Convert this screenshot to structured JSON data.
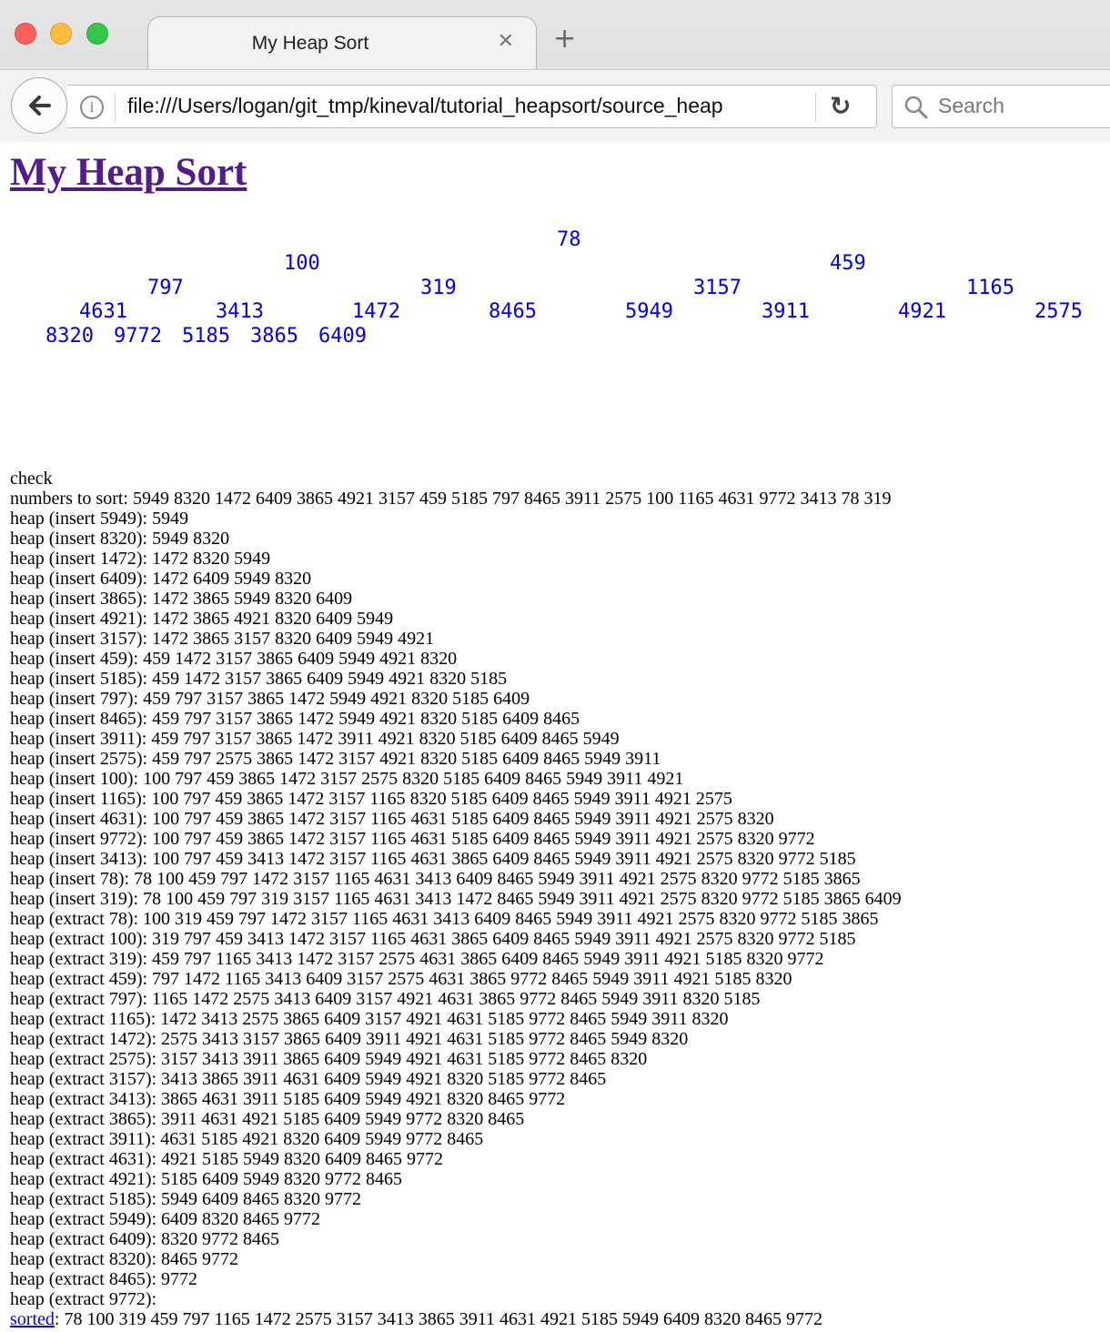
{
  "browser": {
    "tab_title": "My Heap Sort",
    "tab_close": "✕",
    "new_tab": "+",
    "url": "file:///Users/logan/git_tmp/kineval/tutorial_heapsort/source_heap",
    "search_placeholder": "Search"
  },
  "page": {
    "title": "My Heap Sort",
    "heap_rows": [
      [
        "78"
      ],
      [
        "100",
        "459"
      ],
      [
        "797",
        "319",
        "3157",
        "1165"
      ],
      [
        "4631",
        "3413",
        "1472",
        "8465",
        "5949",
        "3911",
        "4921",
        "2575"
      ],
      [
        "8320",
        "9772",
        "5185",
        "3865",
        "6409"
      ]
    ],
    "log_lines": [
      "check",
      "numbers to sort: 5949 8320 1472 6409 3865 4921 3157 459 5185 797 8465 3911 2575 100 1165 4631 9772 3413 78 319",
      "heap (insert 5949): 5949",
      "heap (insert 8320): 5949 8320",
      "heap (insert 1472): 1472 8320 5949",
      "heap (insert 6409): 1472 6409 5949 8320",
      "heap (insert 3865): 1472 3865 5949 8320 6409",
      "heap (insert 4921): 1472 3865 4921 8320 6409 5949",
      "heap (insert 3157): 1472 3865 3157 8320 6409 5949 4921",
      "heap (insert 459): 459 1472 3157 3865 6409 5949 4921 8320",
      "heap (insert 5185): 459 1472 3157 3865 6409 5949 4921 8320 5185",
      "heap (insert 797): 459 797 3157 3865 1472 5949 4921 8320 5185 6409",
      "heap (insert 8465): 459 797 3157 3865 1472 5949 4921 8320 5185 6409 8465",
      "heap (insert 3911): 459 797 3157 3865 1472 3911 4921 8320 5185 6409 8465 5949",
      "heap (insert 2575): 459 797 2575 3865 1472 3157 4921 8320 5185 6409 8465 5949 3911",
      "heap (insert 100): 100 797 459 3865 1472 3157 2575 8320 5185 6409 8465 5949 3911 4921",
      "heap (insert 1165): 100 797 459 3865 1472 3157 1165 8320 5185 6409 8465 5949 3911 4921 2575",
      "heap (insert 4631): 100 797 459 3865 1472 3157 1165 4631 5185 6409 8465 5949 3911 4921 2575 8320",
      "heap (insert 9772): 100 797 459 3865 1472 3157 1165 4631 5185 6409 8465 5949 3911 4921 2575 8320 9772",
      "heap (insert 3413): 100 797 459 3413 1472 3157 1165 4631 3865 6409 8465 5949 3911 4921 2575 8320 9772 5185",
      "heap (insert 78): 78 100 459 797 1472 3157 1165 4631 3413 6409 8465 5949 3911 4921 2575 8320 9772 5185 3865",
      "heap (insert 319): 78 100 459 797 319 3157 1165 4631 3413 1472 8465 5949 3911 4921 2575 8320 9772 5185 3865 6409",
      "heap (extract 78): 100 319 459 797 1472 3157 1165 4631 3413 6409 8465 5949 3911 4921 2575 8320 9772 5185 3865",
      "heap (extract 100): 319 797 459 3413 1472 3157 1165 4631 3865 6409 8465 5949 3911 4921 2575 8320 9772 5185",
      "heap (extract 319): 459 797 1165 3413 1472 3157 2575 4631 3865 6409 8465 5949 3911 4921 5185 8320 9772",
      "heap (extract 459): 797 1472 1165 3413 6409 3157 2575 4631 3865 9772 8465 5949 3911 4921 5185 8320",
      "heap (extract 797): 1165 1472 2575 3413 6409 3157 4921 4631 3865 9772 8465 5949 3911 8320 5185",
      "heap (extract 1165): 1472 3413 2575 3865 6409 3157 4921 4631 5185 9772 8465 5949 3911 8320",
      "heap (extract 1472): 2575 3413 3157 3865 6409 3911 4921 4631 5185 9772 8465 5949 8320",
      "heap (extract 2575): 3157 3413 3911 3865 6409 5949 4921 4631 5185 9772 8465 8320",
      "heap (extract 3157): 3413 3865 3911 4631 6409 5949 4921 8320 5185 9772 8465",
      "heap (extract 3413): 3865 4631 3911 5185 6409 5949 4921 8320 8465 9772",
      "heap (extract 3865): 3911 4631 4921 5185 6409 5949 9772 8320 8465",
      "heap (extract 3911): 4631 5185 4921 8320 6409 5949 9772 8465",
      "heap (extract 4631): 4921 5185 5949 8320 6409 8465 9772",
      "heap (extract 4921): 5185 6409 5949 8320 9772 8465",
      "heap (extract 5185): 5949 6409 8465 8320 9772",
      "heap (extract 5949): 6409 8320 8465 9772",
      "heap (extract 6409): 8320 9772 8465",
      "heap (extract 8320): 8465 9772",
      "heap (extract 8465): 9772",
      "heap (extract 9772):"
    ],
    "sorted_link": "sorted",
    "sorted_values": ": 78 100 319 459 797 1165 1472 2575 3157 3413 3865 3911 4631 4921 5185 5949 6409 8320 8465 9772"
  }
}
